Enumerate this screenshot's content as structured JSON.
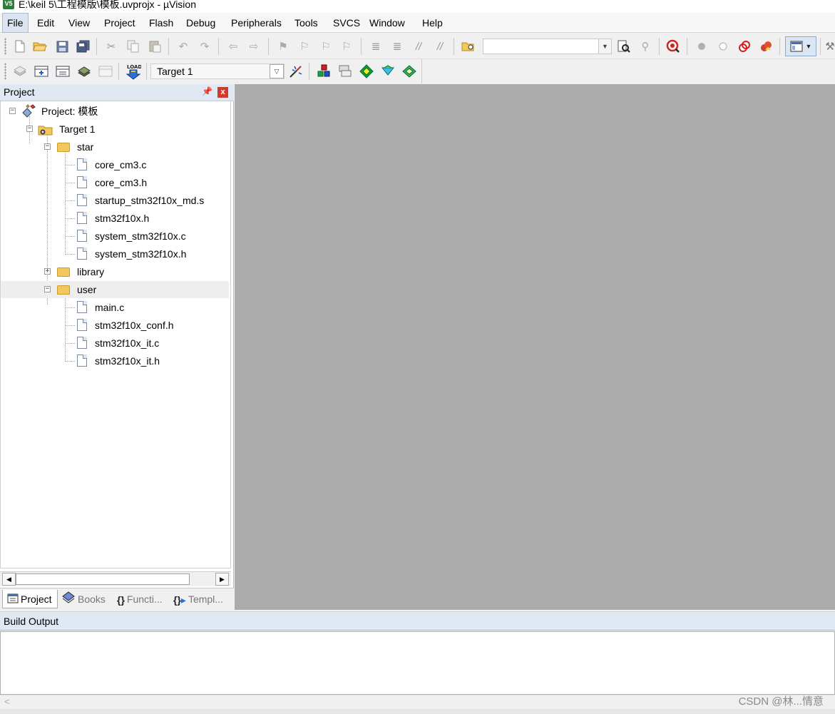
{
  "window": {
    "title": "E:\\keil 5\\工程模版\\模板.uvprojx - µVision",
    "app_icon": "V5"
  },
  "menu": [
    {
      "label": "File",
      "active": true
    },
    {
      "label": "Edit"
    },
    {
      "label": "View"
    },
    {
      "label": "Project"
    },
    {
      "label": "Flash"
    },
    {
      "label": "Debug"
    },
    {
      "label": "Peripherals"
    },
    {
      "label": "Tools"
    },
    {
      "label": "SVCS"
    },
    {
      "label": "Window"
    },
    {
      "label": "Help"
    }
  ],
  "toolbar1": {
    "icons": [
      "new-file-icon",
      "open-file-icon",
      "save-icon",
      "save-all-icon",
      "cut-icon",
      "copy-icon",
      "paste-icon",
      "undo-icon",
      "redo-icon",
      "navigate-back-icon",
      "navigate-forward-icon",
      "bookmark-toggle-icon",
      "bookmark-prev-icon",
      "bookmark-next-icon",
      "bookmark-clear-icon",
      "indent-icon",
      "unindent-icon",
      "comment-icon",
      "uncomment-icon",
      "find-in-files-icon",
      "find-icon",
      "find-replace-icon",
      "debug-start-icon",
      "breakpoint-insert-icon",
      "breakpoint-enable-icon",
      "breakpoint-disable-icon",
      "breakpoint-kill-icon",
      "window-layout-icon",
      "configure-icon"
    ],
    "find_combo_value": ""
  },
  "toolbar2": {
    "icons": [
      "translate-icon",
      "build-icon",
      "rebuild-icon",
      "batch-build-icon",
      "stop-build-icon",
      "download-icon",
      "target-options-icon",
      "manage-components-icon",
      "select-packs-icon",
      "pack-installer-icon",
      "manage-run-time-icon",
      "manage-project-items-icon"
    ],
    "target_value": "Target 1"
  },
  "project_panel": {
    "title": "Project",
    "pin": "ꟼ",
    "close": "x",
    "tree": [
      {
        "label": "Project: 模板",
        "type": "project",
        "level": 0,
        "expander": "−"
      },
      {
        "label": "Target 1",
        "type": "target",
        "level": 1,
        "expander": "−"
      },
      {
        "label": "star",
        "type": "folder",
        "level": 2,
        "expander": "−"
      },
      {
        "label": "core_cm3.c",
        "type": "file",
        "level": 3
      },
      {
        "label": "core_cm3.h",
        "type": "file",
        "level": 3
      },
      {
        "label": "startup_stm32f10x_md.s",
        "type": "file",
        "level": 3
      },
      {
        "label": "stm32f10x.h",
        "type": "file",
        "level": 3
      },
      {
        "label": "system_stm32f10x.c",
        "type": "file",
        "level": 3
      },
      {
        "label": "system_stm32f10x.h",
        "type": "file",
        "level": 3
      },
      {
        "label": "library",
        "type": "folder",
        "level": 2,
        "expander": "+"
      },
      {
        "label": "user",
        "type": "folder",
        "level": 2,
        "expander": "−",
        "selected": true
      },
      {
        "label": "main.c",
        "type": "file",
        "level": 3
      },
      {
        "label": "stm32f10x_conf.h",
        "type": "file",
        "level": 3
      },
      {
        "label": "stm32f10x_it.c",
        "type": "file",
        "level": 3
      },
      {
        "label": "stm32f10x_it.h",
        "type": "file",
        "level": 3
      }
    ],
    "tabs": [
      {
        "label": "Project",
        "icon": "project-tab-icon",
        "active": true
      },
      {
        "label": "Books",
        "icon": "books-icon"
      },
      {
        "label": "Functi...",
        "icon": "functions-icon"
      },
      {
        "label": "Templ...",
        "icon": "templates-icon"
      }
    ]
  },
  "build_output": {
    "title": "Build Output",
    "content": ""
  },
  "watermark": "CSDN @林...情意",
  "colors": {
    "panel_header": "#dfe8f3",
    "editor_background": "#ababab",
    "folder": "#f2c75c"
  }
}
